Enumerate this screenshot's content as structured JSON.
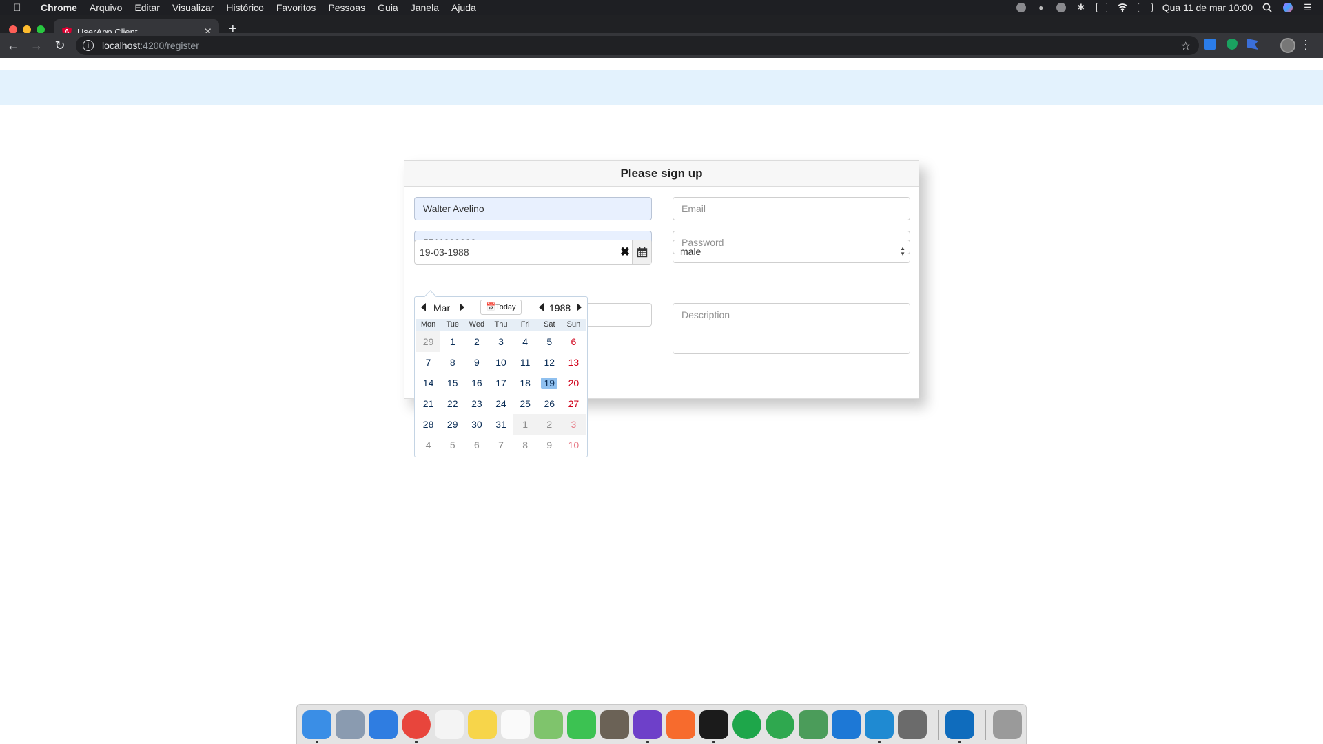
{
  "menubar": {
    "app_name": "Chrome",
    "items": [
      "Arquivo",
      "Editar",
      "Visualizar",
      "Histórico",
      "Favoritos",
      "Pessoas",
      "Guia",
      "Janela",
      "Ajuda"
    ],
    "clock": "Qua 11 de mar  10:00"
  },
  "browser": {
    "tab_title": "UserApp Client",
    "url_host": "localhost",
    "url_path": ":4200/register"
  },
  "form": {
    "title": "Please sign up",
    "name_value": "Walter Avelino",
    "phone_value": "5511000000",
    "email_placeholder": "Email",
    "password_placeholder": "Password",
    "birthdate_value": "19-03-1988",
    "gender_value": "male",
    "description_placeholder": "Description"
  },
  "datepicker": {
    "month": "Mar",
    "year": "1988",
    "today_label": "Today",
    "weekdays": [
      "Mon",
      "Tue",
      "Wed",
      "Thu",
      "Fri",
      "Sat",
      "Sun"
    ],
    "days": [
      {
        "d": "29",
        "other": true
      },
      {
        "d": "1"
      },
      {
        "d": "2"
      },
      {
        "d": "3"
      },
      {
        "d": "4"
      },
      {
        "d": "5"
      },
      {
        "d": "6"
      },
      {
        "d": "7"
      },
      {
        "d": "8"
      },
      {
        "d": "9"
      },
      {
        "d": "10"
      },
      {
        "d": "11"
      },
      {
        "d": "12"
      },
      {
        "d": "13"
      },
      {
        "d": "14"
      },
      {
        "d": "15"
      },
      {
        "d": "16"
      },
      {
        "d": "17"
      },
      {
        "d": "18"
      },
      {
        "d": "19",
        "selected": true
      },
      {
        "d": "20"
      },
      {
        "d": "21"
      },
      {
        "d": "22"
      },
      {
        "d": "23"
      },
      {
        "d": "24"
      },
      {
        "d": "25"
      },
      {
        "d": "26"
      },
      {
        "d": "27"
      },
      {
        "d": "28"
      },
      {
        "d": "29"
      },
      {
        "d": "30"
      },
      {
        "d": "31"
      },
      {
        "d": "1",
        "other": true
      },
      {
        "d": "2",
        "other": true
      },
      {
        "d": "3",
        "other": true
      },
      {
        "d": "4",
        "other": true
      },
      {
        "d": "5",
        "other": true
      },
      {
        "d": "6",
        "other": true
      },
      {
        "d": "7",
        "other": true
      },
      {
        "d": "8",
        "other": true
      },
      {
        "d": "9",
        "other": true
      },
      {
        "d": "10",
        "other": true
      }
    ]
  },
  "dock": {
    "icons": [
      {
        "name": "finder-icon",
        "color": "#3a8ee6",
        "running": true
      },
      {
        "name": "launchpad-icon",
        "color": "#8a9bb0"
      },
      {
        "name": "safari-icon",
        "color": "#2f7de1"
      },
      {
        "name": "chrome-icon",
        "color": "#e8453c",
        "running": true
      },
      {
        "name": "calendar-icon",
        "color": "#f4f4f4"
      },
      {
        "name": "notes-icon",
        "color": "#f7d54a"
      },
      {
        "name": "reminders-icon",
        "color": "#fafafa"
      },
      {
        "name": "maps-icon",
        "color": "#7fc46c"
      },
      {
        "name": "facetime-icon",
        "color": "#3cc252"
      },
      {
        "name": "gimp-icon",
        "color": "#6b6256"
      },
      {
        "name": "github-desktop-icon",
        "color": "#6e40c9",
        "running": true
      },
      {
        "name": "postman-icon",
        "color": "#f76b2d"
      },
      {
        "name": "terminal-icon",
        "color": "#1b1b1b",
        "running": true
      },
      {
        "name": "mongodb-compass-icon",
        "color": "#1ea64a"
      },
      {
        "name": "robo3t-icon",
        "color": "#2fa84f"
      },
      {
        "name": "android-studio-icon",
        "color": "#4b9c5a"
      },
      {
        "name": "xcode-icon",
        "color": "#1d78d6"
      },
      {
        "name": "vscode-icon",
        "color": "#1f8ad2",
        "running": true
      },
      {
        "name": "system-preferences-icon",
        "color": "#6b6b6b"
      },
      {
        "name": "outlook-icon",
        "color": "#0f6cbd",
        "running": true
      },
      {
        "name": "trash-icon",
        "color": "#9a9a9a"
      }
    ]
  }
}
